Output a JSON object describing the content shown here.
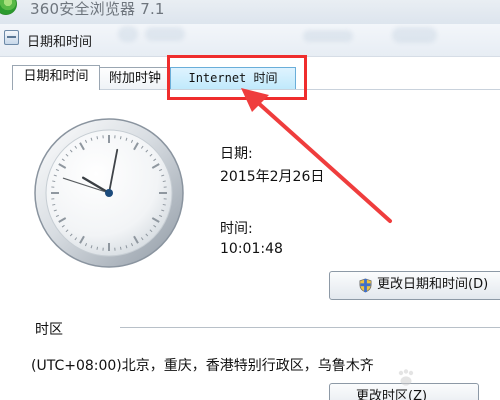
{
  "browser": {
    "title": "360安全浏览器 7.1"
  },
  "dialog": {
    "title": "日期和时间"
  },
  "tabs": [
    {
      "label": "日期和时间"
    },
    {
      "label": "附加时钟"
    },
    {
      "label": "Internet 时间"
    }
  ],
  "date_time": {
    "date_label": "日期:",
    "date_value": "2015年2月26日",
    "time_label": "时间:",
    "time_value": "10:01:48",
    "change_button": "更改日期和时间(D)"
  },
  "timezone": {
    "section_title": "时区",
    "value": "(UTC+08:00)北京，重庆，香港特别行政区，乌鲁木齐",
    "change_button": "更改时区(Z)"
  },
  "colors": {
    "highlight_red": "#ef2d2d",
    "tab_blue": "#bfe9fb"
  },
  "icons": {
    "browser_logo": "browser-logo-icon",
    "dialog_icon": "window-icon",
    "shield": "shield-icon",
    "clock": "analog-clock-icon",
    "arrow": "annotation-arrow-icon"
  },
  "clock": {
    "hour": 10,
    "minute": 1,
    "second": 48
  }
}
